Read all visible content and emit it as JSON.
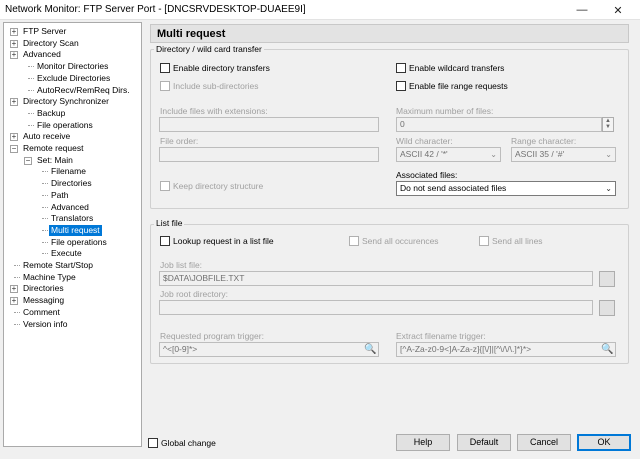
{
  "window": {
    "title": "Network Monitor: FTP Server Port - [DNCSRVDESKTOP-DUAEE9I]",
    "minimize_icon": "minimize-icon",
    "close_icon": "close-icon"
  },
  "tree": {
    "items": [
      {
        "label": "FTP Server",
        "expander": "+"
      },
      {
        "label": "Directory Scan",
        "expander": "+"
      },
      {
        "label": "Advanced",
        "expander": "+"
      },
      {
        "label": "Monitor Directories",
        "expander": ""
      },
      {
        "label": "Exclude Directories",
        "expander": ""
      },
      {
        "label": "AutoRecv/RemReq Dirs.",
        "expander": ""
      },
      {
        "label": "Directory Synchronizer",
        "expander": "+"
      },
      {
        "label": "Backup",
        "expander": ""
      },
      {
        "label": "File operations",
        "expander": ""
      },
      {
        "label": "Auto receive",
        "expander": "+"
      },
      {
        "label": "Remote request",
        "expander": "−"
      },
      {
        "label": "Set: Main",
        "expander": "−"
      },
      {
        "label": "Filename",
        "expander": ""
      },
      {
        "label": "Directories",
        "expander": ""
      },
      {
        "label": "Path",
        "expander": ""
      },
      {
        "label": "Advanced",
        "expander": ""
      },
      {
        "label": "Translators",
        "expander": ""
      },
      {
        "label": "Multi request",
        "expander": "",
        "selected": true
      },
      {
        "label": "File operations",
        "expander": ""
      },
      {
        "label": "Execute",
        "expander": ""
      },
      {
        "label": "Remote Start/Stop",
        "expander": ""
      },
      {
        "label": "Machine Type",
        "expander": ""
      },
      {
        "label": "Directories",
        "expander": "+"
      },
      {
        "label": "Messaging",
        "expander": "+"
      },
      {
        "label": "Comment",
        "expander": ""
      },
      {
        "label": "Version info",
        "expander": ""
      }
    ]
  },
  "panel": {
    "title": "Multi request",
    "dir_group": {
      "title": "Directory / wild card transfer",
      "enable_dir_transfers": "Enable directory transfers",
      "include_subdirs": "Include sub-directories",
      "enable_wildcard": "Enable wildcard transfers",
      "enable_file_range": "Enable file range requests",
      "include_ext_label": "Include files with extensions:",
      "include_ext_value": "",
      "max_files_label": "Maximum number of files:",
      "max_files_value": "0",
      "file_order_label": "File order:",
      "file_order_value": "",
      "wild_char_label": "Wild character:",
      "wild_char_value": "ASCII 42 / '*'",
      "range_char_label": "Range character:",
      "range_char_value": "ASCII 35 / '#'",
      "keep_dir_structure": "Keep directory structure",
      "assoc_files_label": "Associated files:",
      "assoc_files_value": "Do not send associated files"
    },
    "list_group": {
      "title": "List file",
      "lookup_list": "Lookup request in a list file",
      "send_all_occurences": "Send all occurences",
      "send_all_lines": "Send all lines",
      "job_list_label": "Job list file:",
      "job_list_value": "$DATA\\JOBFILE.TXT",
      "job_root_label": "Job root directory:",
      "job_root_value": ""
    },
    "triggers": {
      "requested_label": "Requested program trigger:",
      "requested_value": "^<[0-9]*>",
      "extract_label": "Extract filename trigger:",
      "extract_value": "[^A-Za-z0-9<]A-Za-z]{[\\/]|[^\\/\\/\\.]*}*>"
    }
  },
  "footer": {
    "global_change": "Global change",
    "help": "Help",
    "default": "Default",
    "cancel": "Cancel",
    "ok": "OK"
  },
  "colors": {
    "selection": "#0078d7",
    "background": "#f0f0f0"
  }
}
